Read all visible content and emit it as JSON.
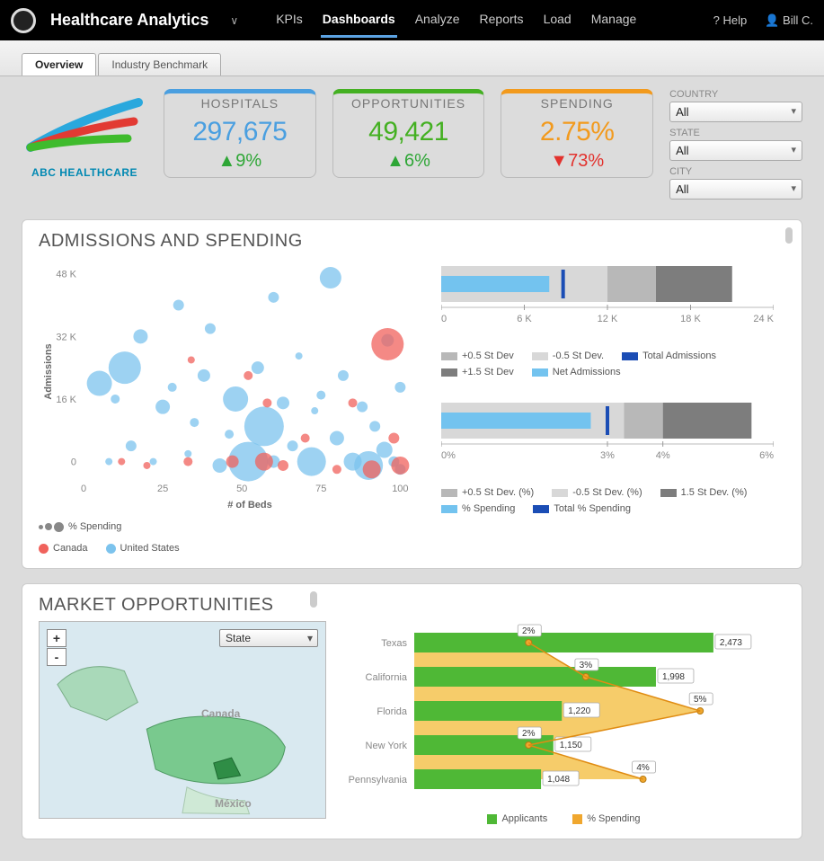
{
  "app": {
    "title": "Healthcare Analytics"
  },
  "nav": {
    "items": [
      "KPIs",
      "Dashboards",
      "Analyze",
      "Reports",
      "Load",
      "Manage"
    ],
    "active": "Dashboards",
    "help": "Help",
    "user": "Bill C."
  },
  "tabs": {
    "items": [
      "Overview",
      "Industry Benchmark"
    ],
    "active": "Overview"
  },
  "brand": {
    "name": "ABC HEALTHCARE"
  },
  "kpis": {
    "hospitals": {
      "label": "HOSPITALS",
      "value": "297,675",
      "delta": "9%",
      "dir": "up"
    },
    "opportunities": {
      "label": "OPPORTUNITIES",
      "value": "49,421",
      "delta": "6%",
      "dir": "up"
    },
    "spending": {
      "label": "SPENDING",
      "value": "2.75%",
      "delta": "73%",
      "dir": "down"
    }
  },
  "filters": {
    "country": {
      "label": "COUNTRY",
      "value": "All"
    },
    "state": {
      "label": "STATE",
      "value": "All"
    },
    "city": {
      "label": "CITY",
      "value": "All"
    }
  },
  "admissions_panel": {
    "title": "ADMISSIONS AND SPENDING",
    "scatter": {
      "xlabel": "# of Beds",
      "ylabel": "Admissions",
      "legend_size": "% Spending",
      "legend_red": "Canada",
      "legend_blue": "United States",
      "xticks": [
        "0",
        "25",
        "50",
        "75",
        "100"
      ],
      "yticks": [
        "0",
        "16 K",
        "32 K",
        "48 K"
      ]
    },
    "bar1": {
      "xticks": [
        "0",
        "6 K",
        "12 K",
        "18 K",
        "24 K"
      ],
      "legend": [
        "+0.5 St Dev",
        "-0.5  St Dev.",
        "Total Admissions",
        "+1.5 St Dev",
        "Net Admissions"
      ]
    },
    "bar2": {
      "xticks": [
        "0%",
        "3%",
        "4%",
        "6%"
      ],
      "legend": [
        "+0.5  St Dev. (%)",
        "-0.5  St Dev. (%)",
        "1.5  St Dev. (%)",
        "% Spending",
        "Total % Spending"
      ]
    }
  },
  "market_panel": {
    "title": "MARKET OPPORTUNITIES",
    "map": {
      "dropdown": "State",
      "labels": [
        "Canada",
        "México"
      ],
      "zoom_in": "+",
      "zoom_out": "-"
    },
    "bars": {
      "legend": {
        "applicants": "Applicants",
        "spending": "% Spending"
      }
    }
  },
  "chart_data": {
    "scatter": {
      "type": "scatter",
      "xlabel": "# of Beds",
      "ylabel": "Admissions",
      "xlim": [
        0,
        105
      ],
      "ylim": [
        -4,
        50
      ],
      "series": [
        {
          "name": "United States",
          "color": "#7cc3ed",
          "points": [
            {
              "x": 5,
              "y": 20,
              "r": 14
            },
            {
              "x": 8,
              "y": 0,
              "r": 4
            },
            {
              "x": 10,
              "y": 16,
              "r": 5
            },
            {
              "x": 13,
              "y": 24,
              "r": 18
            },
            {
              "x": 15,
              "y": 4,
              "r": 6
            },
            {
              "x": 18,
              "y": 32,
              "r": 8
            },
            {
              "x": 22,
              "y": 0,
              "r": 4
            },
            {
              "x": 25,
              "y": 14,
              "r": 8
            },
            {
              "x": 28,
              "y": 19,
              "r": 5
            },
            {
              "x": 30,
              "y": 40,
              "r": 6
            },
            {
              "x": 33,
              "y": 2,
              "r": 4
            },
            {
              "x": 35,
              "y": 10,
              "r": 5
            },
            {
              "x": 38,
              "y": 22,
              "r": 7
            },
            {
              "x": 40,
              "y": 34,
              "r": 6
            },
            {
              "x": 43,
              "y": -1,
              "r": 8
            },
            {
              "x": 46,
              "y": 7,
              "r": 5
            },
            {
              "x": 48,
              "y": 16,
              "r": 14
            },
            {
              "x": 52,
              "y": 0,
              "r": 22
            },
            {
              "x": 55,
              "y": 24,
              "r": 7
            },
            {
              "x": 57,
              "y": 9,
              "r": 22
            },
            {
              "x": 60,
              "y": 42,
              "r": 6
            },
            {
              "x": 60,
              "y": 0,
              "r": 7
            },
            {
              "x": 63,
              "y": 15,
              "r": 7
            },
            {
              "x": 66,
              "y": 4,
              "r": 6
            },
            {
              "x": 68,
              "y": 27,
              "r": 4
            },
            {
              "x": 72,
              "y": 0,
              "r": 16
            },
            {
              "x": 73,
              "y": 13,
              "r": 4
            },
            {
              "x": 75,
              "y": 17,
              "r": 5
            },
            {
              "x": 78,
              "y": 47,
              "r": 12
            },
            {
              "x": 80,
              "y": 6,
              "r": 8
            },
            {
              "x": 82,
              "y": 22,
              "r": 6
            },
            {
              "x": 85,
              "y": 0,
              "r": 10
            },
            {
              "x": 88,
              "y": 14,
              "r": 6
            },
            {
              "x": 90,
              "y": -1,
              "r": 16
            },
            {
              "x": 92,
              "y": 9,
              "r": 6
            },
            {
              "x": 95,
              "y": 3,
              "r": 9
            },
            {
              "x": 96,
              "y": 31,
              "r": 7
            },
            {
              "x": 98,
              "y": 0,
              "r": 6
            },
            {
              "x": 100,
              "y": 19,
              "r": 6
            },
            {
              "x": 100,
              "y": -2,
              "r": 6
            }
          ]
        },
        {
          "name": "Canada",
          "color": "#f0625c",
          "points": [
            {
              "x": 12,
              "y": 0,
              "r": 4
            },
            {
              "x": 20,
              "y": -1,
              "r": 4
            },
            {
              "x": 34,
              "y": 26,
              "r": 4
            },
            {
              "x": 33,
              "y": 0,
              "r": 5
            },
            {
              "x": 47,
              "y": 0,
              "r": 7
            },
            {
              "x": 52,
              "y": 22,
              "r": 5
            },
            {
              "x": 57,
              "y": 0,
              "r": 10
            },
            {
              "x": 58,
              "y": 15,
              "r": 5
            },
            {
              "x": 63,
              "y": -1,
              "r": 6
            },
            {
              "x": 70,
              "y": 6,
              "r": 5
            },
            {
              "x": 80,
              "y": -2,
              "r": 5
            },
            {
              "x": 85,
              "y": 15,
              "r": 5
            },
            {
              "x": 91,
              "y": -2,
              "r": 10
            },
            {
              "x": 96,
              "y": 30,
              "r": 18
            },
            {
              "x": 98,
              "y": 6,
              "r": 6
            },
            {
              "x": 100,
              "y": -1,
              "r": 10
            }
          ]
        }
      ]
    },
    "bullet_admissions": {
      "type": "bar",
      "unit": "count",
      "range": [
        0,
        24000
      ],
      "zones": [
        {
          "to": 12000,
          "color": "#d8d8d8"
        },
        {
          "to": 15500,
          "color": "#b8b8b8"
        },
        {
          "to": 21000,
          "color": "#7d7d7d"
        }
      ],
      "measure": 7800,
      "target": 8800,
      "measure_color": "#73c3ef",
      "target_color": "#1b4db5"
    },
    "bullet_spending": {
      "type": "bar",
      "unit": "percent",
      "range": [
        0,
        6
      ],
      "zones": [
        {
          "to": 3.3,
          "color": "#d8d8d8"
        },
        {
          "to": 4.0,
          "color": "#b8b8b8"
        },
        {
          "to": 5.6,
          "color": "#7d7d7d"
        }
      ],
      "measure": 2.7,
      "target": 3.0,
      "measure_color": "#73c3ef",
      "target_color": "#1b4db5"
    },
    "market_bars": {
      "type": "bar",
      "categories": [
        "Texas",
        "California",
        "Florida",
        "New York",
        "Pennsylvania"
      ],
      "series": [
        {
          "name": "Applicants",
          "color": "#4fb836",
          "values": [
            2473,
            1998,
            1220,
            1150,
            1048
          ]
        },
        {
          "name": "% Spending",
          "color": "#f0a72e",
          "values": [
            2,
            3,
            5,
            2,
            4
          ]
        }
      ],
      "xlim": [
        0,
        2600
      ]
    }
  }
}
